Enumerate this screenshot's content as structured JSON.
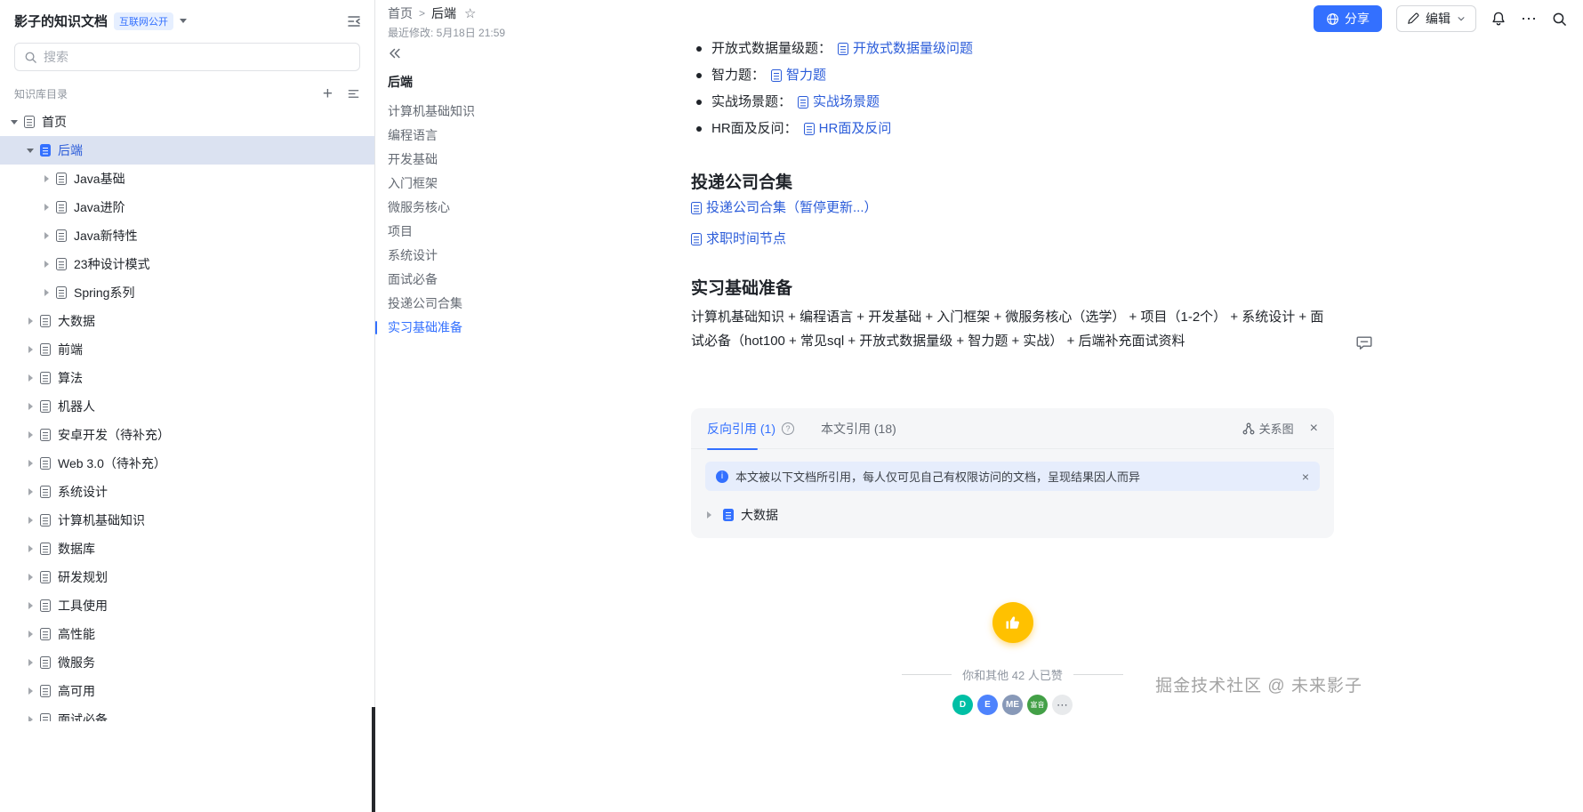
{
  "colors": {
    "accent": "#3370ff",
    "link": "#2b5cd9",
    "selected_bg": "#dbe2f1",
    "like_yellow": "#ffc100",
    "badge_bg": "#e6efff"
  },
  "icons": {
    "star": "☆",
    "close": "×",
    "more": "⋯",
    "plus": "+",
    "help": "?",
    "crumb_sep": ">",
    "info": "i"
  },
  "sidebar": {
    "workspace_title": "影子的知识文档",
    "workspace_badge": "互联网公开",
    "search_placeholder": "搜索",
    "directory_label": "知识库目录",
    "tree": [
      {
        "label": "首页",
        "level": 0,
        "arrow": "down",
        "icon": "doc"
      },
      {
        "label": "后端",
        "level": 1,
        "arrow": "down",
        "icon": "doc-filled",
        "selected": true
      },
      {
        "label": "Java基础",
        "level": 2,
        "arrow": "right",
        "icon": "doc"
      },
      {
        "label": "Java进阶",
        "level": 2,
        "arrow": "right",
        "icon": "doc"
      },
      {
        "label": "Java新特性",
        "level": 2,
        "arrow": "right",
        "icon": "doc"
      },
      {
        "label": "23种设计模式",
        "level": 2,
        "arrow": "right",
        "icon": "doc"
      },
      {
        "label": "Spring系列",
        "level": 2,
        "arrow": "right",
        "icon": "doc"
      },
      {
        "label": "大数据",
        "level": 1,
        "arrow": "right",
        "icon": "doc"
      },
      {
        "label": "前端",
        "level": 1,
        "arrow": "right",
        "icon": "doc"
      },
      {
        "label": "算法",
        "level": 1,
        "arrow": "right",
        "icon": "doc"
      },
      {
        "label": "机器人",
        "level": 1,
        "arrow": "right",
        "icon": "doc"
      },
      {
        "label": "安卓开发（待补充）",
        "level": 1,
        "arrow": "right",
        "icon": "doc"
      },
      {
        "label": "Web 3.0（待补充）",
        "level": 1,
        "arrow": "right",
        "icon": "doc"
      },
      {
        "label": "系统设计",
        "level": 1,
        "arrow": "right",
        "icon": "doc"
      },
      {
        "label": "计算机基础知识",
        "level": 1,
        "arrow": "right",
        "icon": "doc"
      },
      {
        "label": "数据库",
        "level": 1,
        "arrow": "right",
        "icon": "doc"
      },
      {
        "label": "研发规划",
        "level": 1,
        "arrow": "right",
        "icon": "doc"
      },
      {
        "label": "工具使用",
        "level": 1,
        "arrow": "right",
        "icon": "doc"
      },
      {
        "label": "高性能",
        "level": 1,
        "arrow": "right",
        "icon": "doc"
      },
      {
        "label": "微服务",
        "level": 1,
        "arrow": "right",
        "icon": "doc"
      },
      {
        "label": "高可用",
        "level": 1,
        "arrow": "right",
        "icon": "doc"
      },
      {
        "label": "面试必备",
        "level": 1,
        "arrow": "right",
        "icon": "doc"
      }
    ]
  },
  "topbar": {
    "breadcrumb_home": "首页",
    "breadcrumb_current": "后端",
    "modified": "最近修改: 5月18日 21:59",
    "share_label": "分享",
    "edit_label": "编辑"
  },
  "toc": {
    "title": "后端",
    "items": [
      {
        "label": "计算机基础知识"
      },
      {
        "label": "编程语言"
      },
      {
        "label": "开发基础"
      },
      {
        "label": "入门框架"
      },
      {
        "label": "微服务核心"
      },
      {
        "label": "项目"
      },
      {
        "label": "系统设计"
      },
      {
        "label": "面试必备"
      },
      {
        "label": "投递公司合集"
      },
      {
        "label": "实习基础准备",
        "active": true
      }
    ]
  },
  "content": {
    "bullets": [
      {
        "label": "开放式数据量级题：",
        "link": "开放式数据量级问题"
      },
      {
        "label": "智力题：",
        "link": "智力题"
      },
      {
        "label": "实战场景题：",
        "link": "实战场景题"
      },
      {
        "label": "HR面及反问：",
        "link": "HR面及反问"
      }
    ],
    "section1_title": "投递公司合集",
    "section1_links": [
      "投递公司合集（暂停更新...）",
      "求职时间节点"
    ],
    "section2_title": "实习基础准备",
    "section2_text": "计算机基础知识 + 编程语言 + 开发基础 + 入门框架 + 微服务核心（选学） + 项目（1-2个） + 系统设计 + 面试必备（hot100 + 常见sql + 开放式数据量级 + 智力题 + 实战） + 后端补充面试资料"
  },
  "references": {
    "tab_backlinks": "反向引用 (1)",
    "tab_citations": "本文引用 (18)",
    "graph_label": "关系图",
    "notice": "本文被以下文档所引用，每人仅可见自己有权限访问的文档，呈现结果因人而异",
    "doc_label": "大数据"
  },
  "footer": {
    "likes_text": "你和其他 42 人已赞",
    "avatars": [
      {
        "text": "D",
        "bg": "#00bfa5"
      },
      {
        "text": "E",
        "bg": "#4e83fd"
      },
      {
        "text": "ME",
        "bg": "#8899b8"
      },
      {
        "text": "富音",
        "bg": "#43a047",
        "tiny": true
      }
    ],
    "watermark": "掘金技术社区 @ 未来影子"
  }
}
